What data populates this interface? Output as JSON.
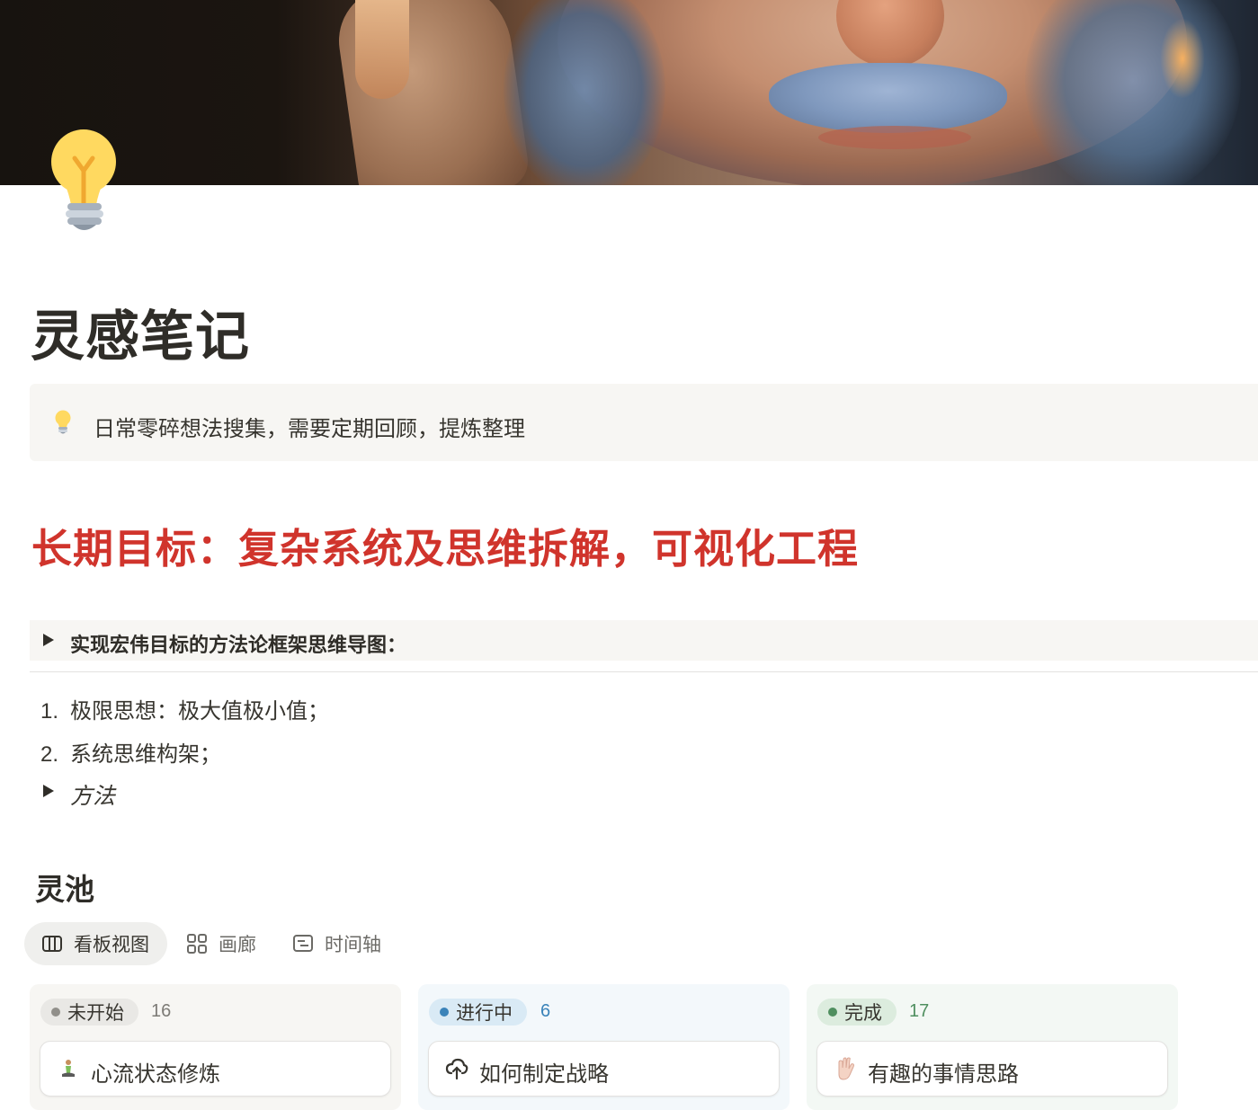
{
  "page": {
    "title": "灵感笔记",
    "cover_icon": "lightbulb-icon",
    "callout": {
      "icon": "lightbulb-icon",
      "text": "日常零碎想法搜集，需要定期回顾，提炼整理"
    },
    "goal_heading": "长期目标：复杂系统及思维拆解，可视化工程",
    "toggle_heading": "实现宏伟目标的方法论框架思维导图：",
    "list": [
      {
        "num": "1.",
        "text": "极限思想：极大值极小值；"
      },
      {
        "num": "2.",
        "text": "系统思维构架；"
      }
    ],
    "toggle_item": "方法"
  },
  "database": {
    "title": "灵池",
    "views": [
      {
        "label": "看板视图",
        "icon": "board-icon",
        "active": true
      },
      {
        "label": "画廊",
        "icon": "gallery-icon",
        "active": false
      },
      {
        "label": "时间轴",
        "icon": "timeline-icon",
        "active": false
      }
    ],
    "columns": [
      {
        "status": "未开始",
        "count": "16",
        "color": "#918f8a",
        "cards": [
          {
            "title": "心流状态修炼",
            "icon": "meditation-person-icon"
          }
        ]
      },
      {
        "status": "进行中",
        "count": "6",
        "color": "#3a83b9",
        "cards": [
          {
            "title": "如何制定战略",
            "icon": "cloud-upload-icon"
          }
        ]
      },
      {
        "status": "完成",
        "count": "17",
        "color": "#4f8f5f",
        "cards": [
          {
            "title": "有趣的事情思路",
            "icon": "vulcan-hand-icon"
          }
        ]
      }
    ]
  }
}
